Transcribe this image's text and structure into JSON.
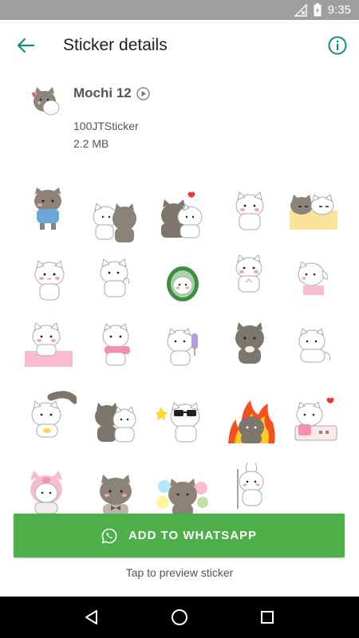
{
  "status_bar": {
    "time": "9:35",
    "icons": [
      "signal-off-icon",
      "battery-charging-icon"
    ]
  },
  "app_bar": {
    "title": "Sticker details",
    "back_icon": "arrow-back-icon",
    "info_icon": "info-icon"
  },
  "pack": {
    "name": "Mochi 12",
    "publisher": "100JTSticker",
    "size": "2.2 MB"
  },
  "stickers": [
    {
      "name": "cat-grey-blue-shirt"
    },
    {
      "name": "cats-hugging"
    },
    {
      "name": "cats-heart"
    },
    {
      "name": "cat-white"
    },
    {
      "name": "cats-blanket"
    },
    {
      "name": "cat-white-waving"
    },
    {
      "name": "cat-white-thinking"
    },
    {
      "name": "cat-melon"
    },
    {
      "name": "cat-white-hands"
    },
    {
      "name": "cat-pink-bag"
    },
    {
      "name": "cat-pink-sign"
    },
    {
      "name": "cat-pink-scarf"
    },
    {
      "name": "cat-ice-cream"
    },
    {
      "name": "cat-grey-clapping"
    },
    {
      "name": "cat-white-walking"
    },
    {
      "name": "cat-tail"
    },
    {
      "name": "cats-two"
    },
    {
      "name": "cat-sunglasses"
    },
    {
      "name": "cat-fire"
    },
    {
      "name": "cat-tablet"
    },
    {
      "name": "cat-pig-hat"
    },
    {
      "name": "cat-bowtie"
    },
    {
      "name": "cat-balloons"
    },
    {
      "name": "cat-bunny"
    }
  ],
  "actions": {
    "add_label": "ADD TO WHATSAPP",
    "hint": "Tap to preview sticker"
  },
  "colors": {
    "accent": "#128c7e",
    "button": "#4caf4a",
    "status_bar": "#9e9e9e",
    "nav_bar": "#000000"
  }
}
